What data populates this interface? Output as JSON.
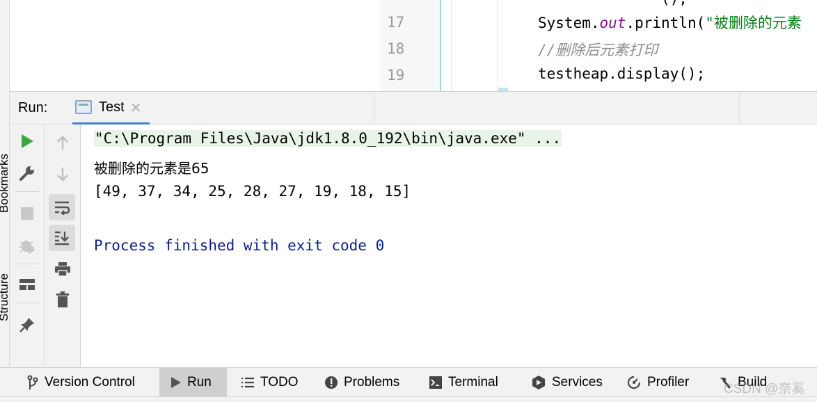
{
  "editor": {
    "lines": [
      {
        "number": "17",
        "code_prefix": "System.",
        "code_field": "out",
        "code_call": ".println(",
        "code_string": "\"被删除的元素"
      },
      {
        "number": "18",
        "comment": "//删除后元素打印"
      },
      {
        "number": "19",
        "code": "testheap.display();"
      }
    ]
  },
  "run_panel": {
    "label": "Run:",
    "tab": {
      "label": "Test",
      "close_glyph": "×"
    },
    "left_stripe_labels": [
      "Bookmarks",
      "Structure"
    ]
  },
  "console": {
    "lines": [
      "\"C:\\Program Files\\Java\\jdk1.8.0_192\\bin\\java.exe\" ...",
      "被删除的元素是65",
      "[49, 37, 34, 25, 28, 27, 19, 18, 15]",
      "",
      "Process finished with exit code 0"
    ]
  },
  "toolbar": {
    "rerun": "rerun-icon",
    "modify": "wrench-icon",
    "stop": "stop-icon",
    "debug": "debug-icon",
    "layout": "layout-icon",
    "pin": "pin-icon",
    "up": "arrow-up-icon",
    "down": "arrow-down-icon",
    "soft_wrap": "soft-wrap-icon",
    "scroll_end": "scroll-to-end-icon",
    "print": "print-icon",
    "clear": "trash-icon"
  },
  "bottom_tabs": [
    {
      "label": "Version Control",
      "icon": "vcs-branch-icon"
    },
    {
      "label": "Run",
      "icon": "play-icon",
      "active": true
    },
    {
      "label": "TODO",
      "icon": "list-icon"
    },
    {
      "label": "Problems",
      "icon": "warning-icon"
    },
    {
      "label": "Terminal",
      "icon": "terminal-icon"
    },
    {
      "label": "Services",
      "icon": "services-icon"
    },
    {
      "label": "Profiler",
      "icon": "profiler-icon"
    },
    {
      "label": "Build",
      "icon": "hammer-icon"
    }
  ],
  "watermark": "CSDN @奈奚",
  "colors": {
    "accent": "#4083c9",
    "run_green": "#3ba83f",
    "exit_text": "#0c1e8a",
    "string": "#067d17",
    "field": "#871094",
    "comment": "#8c8c8c"
  }
}
